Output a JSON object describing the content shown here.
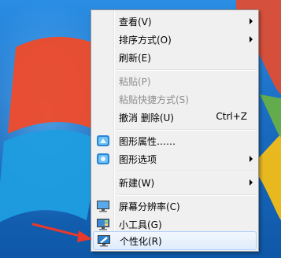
{
  "context_menu": {
    "items": [
      {
        "label": "查看(V)",
        "submenu": true
      },
      {
        "label": "排序方式(O)",
        "submenu": true
      },
      {
        "label": "刷新(E)"
      },
      {
        "label": "粘贴(P)",
        "disabled": true
      },
      {
        "label": "粘贴快捷方式(S)",
        "disabled": true
      },
      {
        "label": "撤消 删除(U)",
        "shortcut": "Ctrl+Z"
      },
      {
        "label": "图形属性……",
        "icon": "graphics-properties-icon"
      },
      {
        "label": "图形选项",
        "icon": "graphics-options-icon",
        "submenu": true
      },
      {
        "label": "新建(W)",
        "submenu": true
      },
      {
        "label": "屏幕分辨率(C)",
        "icon": "screen-resolution-icon"
      },
      {
        "label": "小工具(G)",
        "icon": "gadgets-icon"
      },
      {
        "label": "个性化(R)",
        "icon": "personalize-icon",
        "highlighted": true
      }
    ]
  },
  "colors": {
    "desktop": "#1a6fc4",
    "menu_bg": "#f0f0f0",
    "highlight": "#dfecfb",
    "annotation_arrow": "#e8392b"
  }
}
